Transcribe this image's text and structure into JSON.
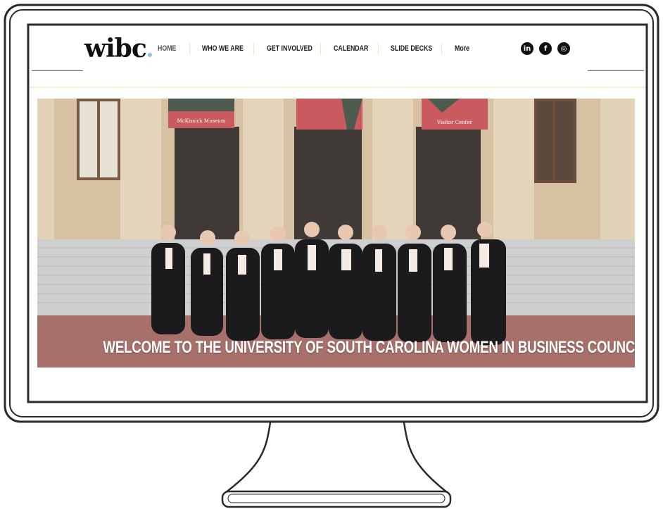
{
  "brand": {
    "logo_text": "wibc"
  },
  "nav": {
    "items": [
      {
        "label": "HOME",
        "active": true
      },
      {
        "label": "WHO WE ARE"
      },
      {
        "label": "GET INVOLVED"
      },
      {
        "label": "CALENDAR"
      },
      {
        "label": "SLIDE DECKS"
      },
      {
        "label": "More"
      }
    ]
  },
  "social": {
    "icons": [
      "linkedin-icon",
      "facebook-icon",
      "instagram-icon"
    ],
    "glyphs": [
      "in",
      "f",
      "◎"
    ]
  },
  "hero": {
    "headline": "WELCOME TO THE UNIVERSITY OF SOUTH CAROLINA WOMEN IN BUSINESS COUNCIL",
    "banners": [
      "McKissick Museum",
      "",
      "Visitor Center"
    ]
  },
  "colors": {
    "logo_dot": "#7fc7e6",
    "nav_separator": "#f2e7c0",
    "banner_red": "#c95a5f",
    "banner_green": "#4d5b4e",
    "column_stone": "#d8c3a4",
    "brick": "#a8706a",
    "steps": "#cfcfcf"
  }
}
